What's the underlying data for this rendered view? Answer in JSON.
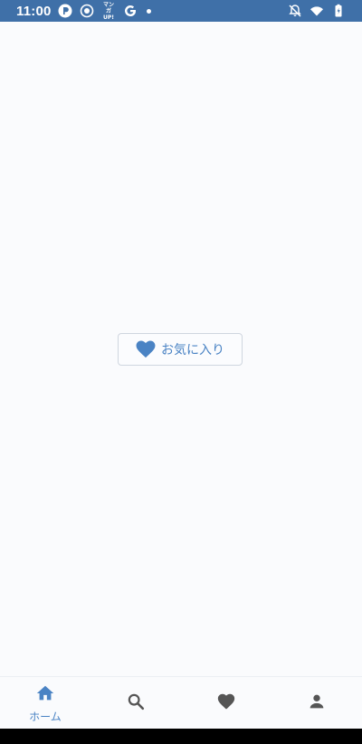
{
  "status_bar": {
    "time": "11:00",
    "left_icons": [
      "p-app-icon",
      "record-icon",
      "manga-app-icon",
      "google-icon",
      "notification-dot-icon"
    ],
    "manga_text_top": "マンガ",
    "manga_text_bottom": "UP!",
    "right_icons": [
      "notifications-off-icon",
      "wifi-icon",
      "battery-icon"
    ],
    "color": "#3f70a8"
  },
  "main": {
    "favorites_button_label": "お気に入り",
    "accent_color": "#4a83c4"
  },
  "bottom_nav": {
    "items": [
      {
        "id": "home",
        "label": "ホーム",
        "icon": "home-icon",
        "active": true
      },
      {
        "id": "search",
        "label": "",
        "icon": "search-icon",
        "active": false
      },
      {
        "id": "favorites",
        "label": "",
        "icon": "heart-icon",
        "active": false
      },
      {
        "id": "profile",
        "label": "",
        "icon": "person-icon",
        "active": false
      }
    ],
    "active_color": "#4a83c4",
    "inactive_color": "#555555"
  }
}
